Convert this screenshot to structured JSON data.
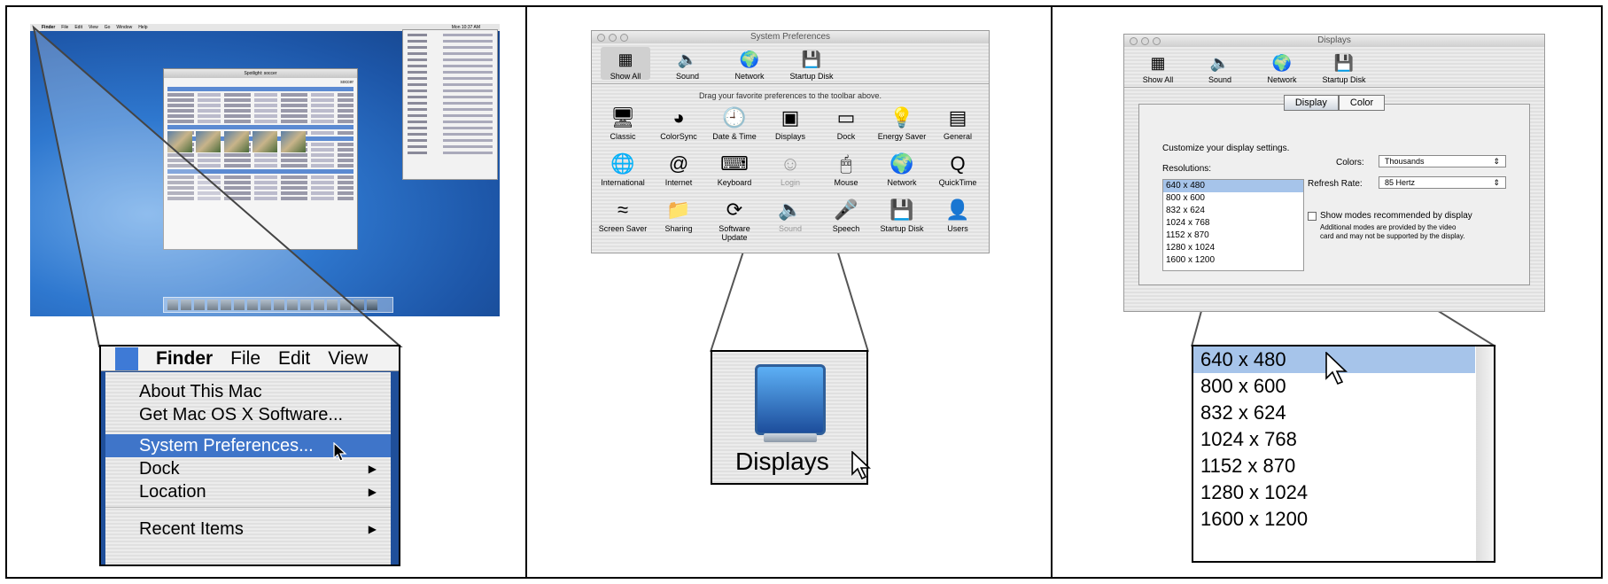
{
  "panel1": {
    "desktop_menu": [
      "Finder",
      "File",
      "Edit",
      "View",
      "Go",
      "Window",
      "Help"
    ],
    "desktop_clock": "Mon 10:37 AM",
    "spotlight_title": "Spotlight: soccer",
    "spotlight_search": "soccer",
    "zoom_menu": {
      "app": "Finder",
      "menus": [
        "File",
        "Edit",
        "View"
      ],
      "items": [
        {
          "label": "About This Mac",
          "submenu": false,
          "selected": false
        },
        {
          "label": "Get Mac OS X Software...",
          "submenu": false,
          "selected": false
        },
        {
          "label": "System Preferences...",
          "submenu": false,
          "selected": true
        },
        {
          "label": "Dock",
          "submenu": true,
          "selected": false
        },
        {
          "label": "Location",
          "submenu": true,
          "selected": false
        },
        {
          "label": "Recent Items",
          "submenu": true,
          "selected": false
        }
      ]
    }
  },
  "panel2": {
    "window_title": "System Preferences",
    "toolbar": [
      "Show All",
      "Sound",
      "Network",
      "Startup Disk"
    ],
    "hint": "Drag your favorite preferences to the toolbar above.",
    "icons": [
      {
        "label": "Classic",
        "icon": "classic-icon",
        "glyph": "🖥",
        "dim": false
      },
      {
        "label": "ColorSync",
        "icon": "colorsync-icon",
        "glyph": "◕",
        "dim": false
      },
      {
        "label": "Date & Time",
        "icon": "clock-icon",
        "glyph": "🕘",
        "dim": false
      },
      {
        "label": "Displays",
        "icon": "display-icon",
        "glyph": "▣",
        "dim": false
      },
      {
        "label": "Dock",
        "icon": "dock-icon",
        "glyph": "▭",
        "dim": false
      },
      {
        "label": "Energy Saver",
        "icon": "lightbulb-icon",
        "glyph": "💡",
        "dim": false
      },
      {
        "label": "General",
        "icon": "general-icon",
        "glyph": "▤",
        "dim": false
      },
      {
        "label": "International",
        "icon": "flag-icon",
        "glyph": "🌐",
        "dim": false
      },
      {
        "label": "Internet",
        "icon": "at-icon",
        "glyph": "@",
        "dim": false
      },
      {
        "label": "Keyboard",
        "icon": "keyboard-icon",
        "glyph": "⌨",
        "dim": false
      },
      {
        "label": "Login",
        "icon": "login-icon",
        "glyph": "☺",
        "dim": true
      },
      {
        "label": "Mouse",
        "icon": "mouse-icon",
        "glyph": "🖱",
        "dim": false
      },
      {
        "label": "Network",
        "icon": "globe-icon",
        "glyph": "🌍",
        "dim": false
      },
      {
        "label": "QuickTime",
        "icon": "quicktime-icon",
        "glyph": "Q",
        "dim": false
      },
      {
        "label": "Screen Saver",
        "icon": "screensaver-icon",
        "glyph": "≈",
        "dim": false
      },
      {
        "label": "Sharing",
        "icon": "sharing-icon",
        "glyph": "📁",
        "dim": false
      },
      {
        "label": "Software Update",
        "icon": "update-icon",
        "glyph": "⟳",
        "dim": false
      },
      {
        "label": "Sound",
        "icon": "speaker-icon",
        "glyph": "🔈",
        "dim": true
      },
      {
        "label": "Speech",
        "icon": "microphone-icon",
        "glyph": "🎤",
        "dim": false
      },
      {
        "label": "Startup Disk",
        "icon": "disk-icon",
        "glyph": "💾",
        "dim": false
      },
      {
        "label": "Users",
        "icon": "users-icon",
        "glyph": "👤",
        "dim": false
      }
    ],
    "zoom_label": "Displays"
  },
  "panel3": {
    "window_title": "Displays",
    "toolbar": [
      "Show All",
      "Sound",
      "Network",
      "Startup Disk"
    ],
    "tabs": [
      "Display",
      "Color"
    ],
    "active_tab": "Display",
    "intro": "Customize your display settings.",
    "resolutions_label": "Resolutions:",
    "colors_label": "Colors:",
    "colors_value": "Thousands",
    "refresh_label": "Refresh Rate:",
    "refresh_value": "85 Hertz",
    "checkbox_label": "Show modes recommended by display",
    "note_line1": "Additional modes are provided by the video",
    "note_line2": "card and may not be supported by the display.",
    "resolutions": [
      "640 x 480",
      "800 x 600",
      "832 x 624",
      "1024 x 768",
      "1152 x 870",
      "1280 x 1024",
      "1600 x 1200"
    ],
    "selected_resolution": "640 x 480"
  }
}
